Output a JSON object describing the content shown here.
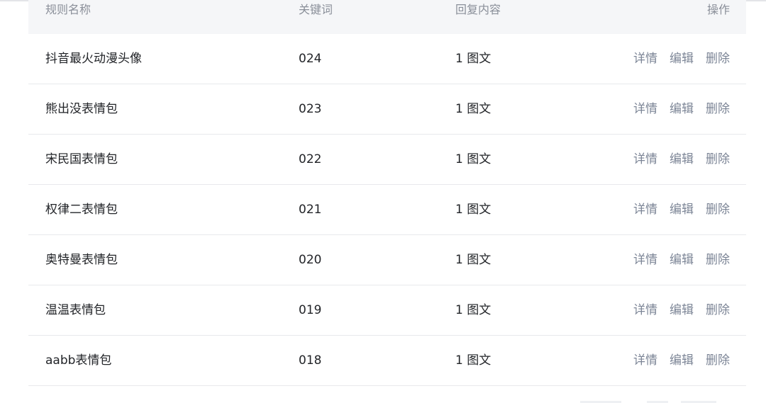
{
  "table": {
    "columns": {
      "name": "规则名称",
      "keyword": "关键词",
      "reply": "回复内容",
      "actions": "操作"
    },
    "rows": [
      {
        "name": "抖音最火动漫头像",
        "keyword": "024",
        "reply": "1 图文"
      },
      {
        "name": "熊出没表情包",
        "keyword": "023",
        "reply": "1 图文"
      },
      {
        "name": "宋民国表情包",
        "keyword": "022",
        "reply": "1 图文"
      },
      {
        "name": "权律二表情包",
        "keyword": "021",
        "reply": "1 图文"
      },
      {
        "name": "奥特曼表情包",
        "keyword": "020",
        "reply": "1 图文"
      },
      {
        "name": "温温表情包",
        "keyword": "019",
        "reply": "1 图文"
      },
      {
        "name": "aabb表情包",
        "keyword": "018",
        "reply": "1 图文"
      }
    ],
    "action_labels": {
      "detail": "详情",
      "edit": "编辑",
      "delete": "删除"
    }
  },
  "colors": {
    "header_bg": "#f5f6f8",
    "header_text": "#8a8f99",
    "body_text": "#222428",
    "action_text": "#7c8596",
    "row_divider": "#e8e9ec"
  }
}
